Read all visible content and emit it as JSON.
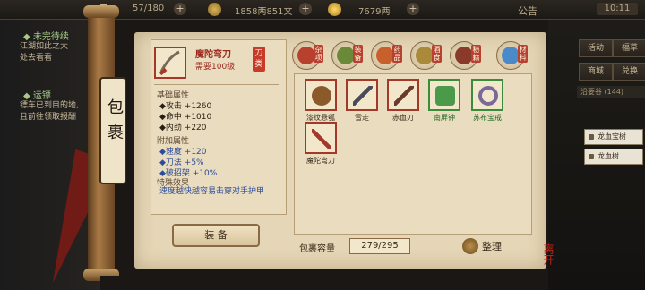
{
  "topbar": {
    "stamina": "57/180",
    "silver": "1858两851文",
    "gold": "7679两",
    "notice_label": "公告",
    "clock": "10:11"
  },
  "quests": [
    {
      "status": "◆ 未完待续",
      "text": [
        "江湖如此之大",
        "处去看看"
      ]
    },
    {
      "status": "◆ 运镖",
      "text": [
        "镖车已到目的地,",
        "且前往领取报酬"
      ]
    }
  ],
  "bag_label": "包裹",
  "detail": {
    "name": "魔陀弯刀",
    "level": "需要100级",
    "type": "刀类",
    "base_title": "基础属性",
    "base_stats": [
      "◆攻击 +1260",
      "◆命中 +1010",
      "◆内劲 +220"
    ],
    "extra_title": "附加属性",
    "extra_stats": [
      "◆速度 +120",
      "◆刀法 +5%",
      "◆破招架 +10%"
    ],
    "special_title": "特殊效果",
    "special_text": "速度越快越容易击穿对手护甲",
    "equip_button": "装 备"
  },
  "categories": [
    {
      "label": "杂项",
      "color": "#b8402e"
    },
    {
      "label": "装备",
      "color": "#6a8a3a"
    },
    {
      "label": "药品",
      "color": "#c8602e"
    },
    {
      "label": "酒食",
      "color": "#a88a3a"
    },
    {
      "label": "秘籍",
      "color": "#8a3a2a"
    },
    {
      "label": "材料",
      "color": "#4a8ac8"
    }
  ],
  "items": [
    {
      "name": "漆纹悬瓠",
      "border": "red",
      "art_color": "#8a5a2a"
    },
    {
      "name": "雪走",
      "border": "red",
      "art_color": "#4a4a5a"
    },
    {
      "name": "赤血刃",
      "border": "red",
      "art_color": "#6a3a2a"
    },
    {
      "name": "南屏钟",
      "border": "green",
      "art_color": "#4a9a4a"
    },
    {
      "name": "苏布宝戒",
      "border": "green",
      "art_color": "#7a6a9a"
    },
    {
      "name": "魔陀弯刀",
      "border": "red",
      "art_color": "#a4392a"
    }
  ],
  "capacity_label": "包裹容量",
  "capacity_value": "279/295",
  "sort_label": "整理",
  "right_menu": [
    "活动",
    "福草",
    "商城",
    "兑换"
  ],
  "level_text": "沿要谷 (144)",
  "side_items": [
    "龙血宝树",
    "龙血树"
  ],
  "close_seal": "离开"
}
